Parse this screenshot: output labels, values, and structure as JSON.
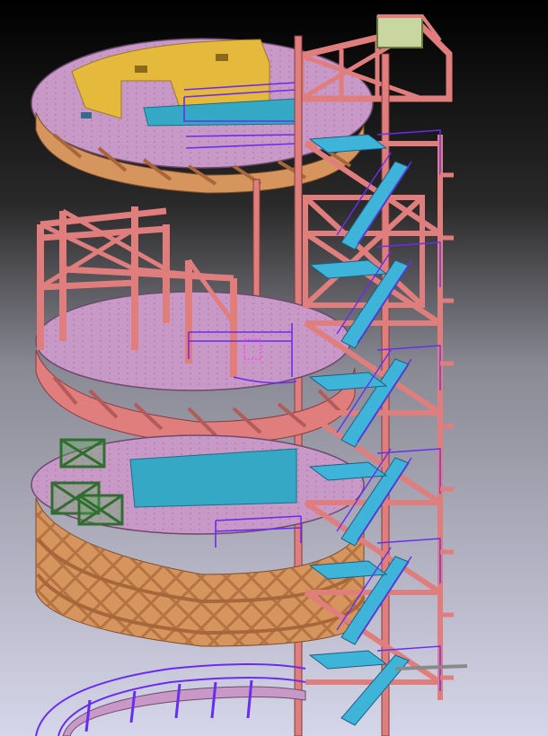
{
  "view": {
    "background_top": "#000000",
    "background_mid": "#505050",
    "background_bottom": "#d6d6ea"
  },
  "palette": {
    "steel_pink": "#e07e7e",
    "steel_pink_dark": "#b35a5a",
    "steel_orange": "#d7955e",
    "steel_orange_dark": "#a7673a",
    "deck_lilac": "#c898c7",
    "deck_lilac_dark": "#9c6f9c",
    "deck_yellow": "#e5b93c",
    "deck_cyan": "#35a8c6",
    "handrail_purple": "#6a2cf0",
    "stair_cyan": "#3fb4d9",
    "module_green": "#5aa85a",
    "module_green_dark": "#2f6e2f",
    "edge_black": "#2a1a1a"
  },
  "levels": [
    {
      "name": "upper-deck",
      "deck": "lilac-yellow",
      "frame": "pink"
    },
    {
      "name": "middle-deck",
      "deck": "lilac",
      "frame": "pink"
    },
    {
      "name": "lower-deck",
      "deck": "lilac-cyan",
      "frame": "orange"
    },
    {
      "name": "bottom-walkway",
      "deck": "none",
      "frame": "handrail-only"
    }
  ],
  "icons": {
    "column": "vertical-column",
    "stair": "stair-flight"
  }
}
